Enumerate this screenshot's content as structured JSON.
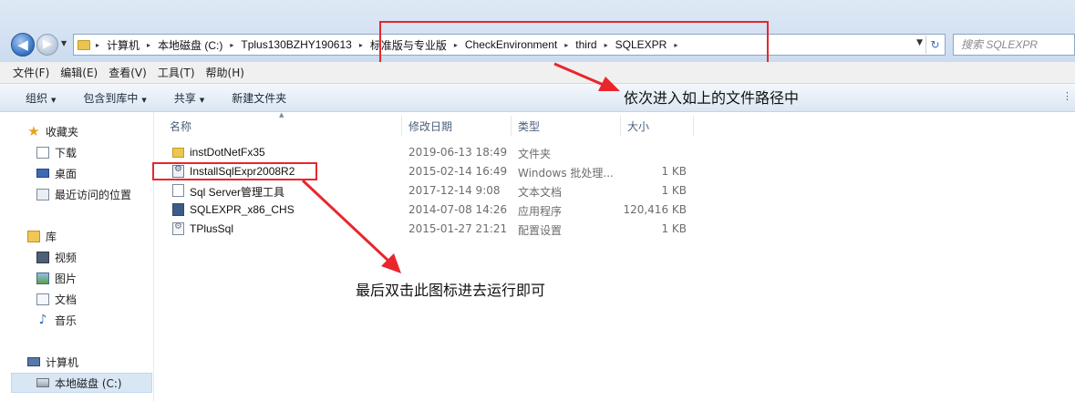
{
  "nav": {
    "back_glyph": "◀",
    "forward_glyph": "▶"
  },
  "address": {
    "crumbs": [
      "计算机",
      "本地磁盘 (C:)",
      "Tplus130BZHY190613",
      "标准版与专业版",
      "CheckEnvironment",
      "third",
      "SQLEXPR"
    ],
    "separator": "▸"
  },
  "search": {
    "placeholder": "搜索 SQLEXPR"
  },
  "menu": [
    "文件(F)",
    "编辑(E)",
    "查看(V)",
    "工具(T)",
    "帮助(H)"
  ],
  "toolbar": {
    "organize": "组织",
    "include_library": "包含到库中",
    "share": "共享",
    "new_folder": "新建文件夹"
  },
  "sidebar": {
    "favorites": "收藏夹",
    "downloads": "下载",
    "desktop": "桌面",
    "recent": "最近访问的位置",
    "libraries": "库",
    "videos": "视频",
    "pictures": "图片",
    "documents": "文档",
    "music": "音乐",
    "computer": "计算机",
    "local_disk": "本地磁盘 (C:)"
  },
  "columns": {
    "name": "名称",
    "date": "修改日期",
    "type": "类型",
    "size": "大小"
  },
  "files": [
    {
      "name": "instDotNetFx35",
      "date": "2019-06-13 18:49",
      "type": "文件夹",
      "size": "",
      "icon": "folder-icon"
    },
    {
      "name": "InstallSqlExpr2008R2",
      "date": "2015-02-14 16:49",
      "type": "Windows 批处理...",
      "size": "1 KB",
      "icon": "batch-file-icon"
    },
    {
      "name": "Sql Server管理工具",
      "date": "2017-12-14 9:08",
      "type": "文本文档",
      "size": "1 KB",
      "icon": "text-file-icon"
    },
    {
      "name": "SQLEXPR_x86_CHS",
      "date": "2014-07-08 14:26",
      "type": "应用程序",
      "size": "120,416 KB",
      "icon": "application-icon"
    },
    {
      "name": "TPlusSql",
      "date": "2015-01-27 21:21",
      "type": "配置设置",
      "size": "1 KB",
      "icon": "config-file-icon"
    }
  ],
  "annotations": {
    "path_note": "依次进入如上的文件路径中",
    "run_note": "最后双击此图标进去运行即可"
  },
  "colors": {
    "highlight": "#e8262c",
    "selection": "#d9e7f5"
  }
}
